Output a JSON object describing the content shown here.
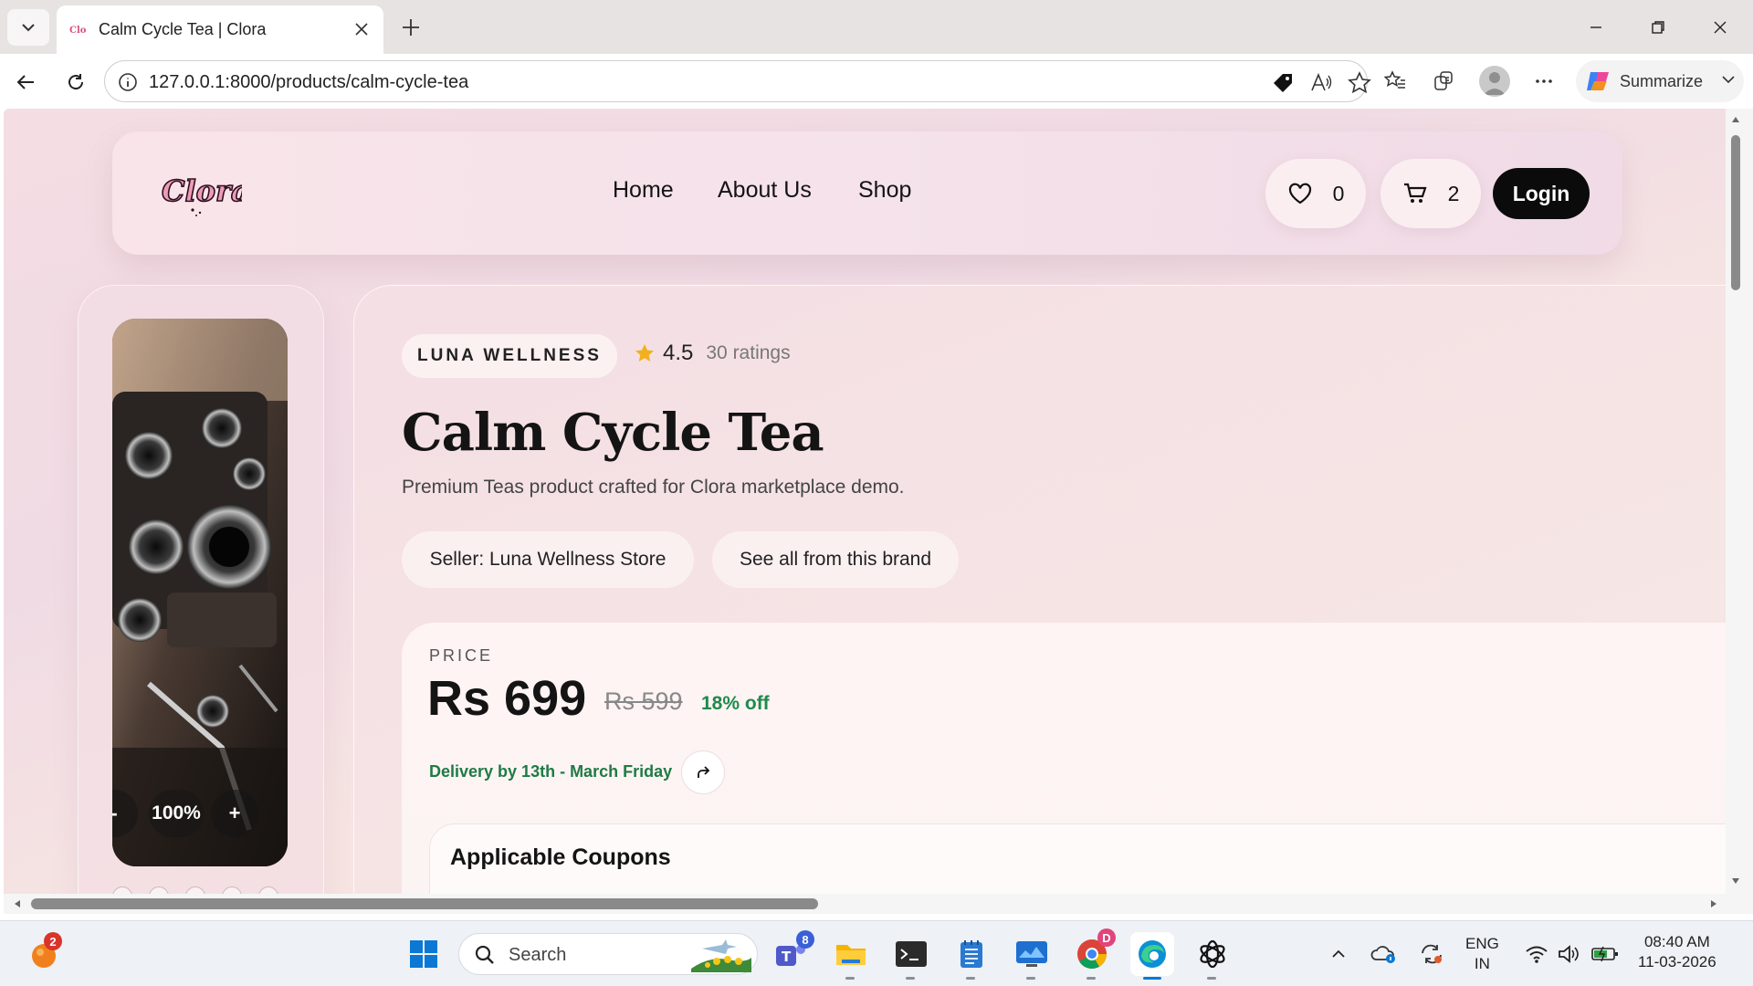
{
  "browser": {
    "tab_title": "Calm Cycle Tea | Clora",
    "url": "127.0.0.1:8000/products/calm-cycle-tea",
    "summarize_label": "Summarize"
  },
  "header": {
    "logo_text": "Clora",
    "nav": [
      "Home",
      "About Us",
      "Shop"
    ],
    "wishlist_count": "0",
    "cart_count": "2",
    "login_label": "Login"
  },
  "gallery": {
    "zoom_out": "-",
    "zoom_level": "100%",
    "zoom_in": "+"
  },
  "product": {
    "brand": "LUNA WELLNESS",
    "rating": "4.5",
    "rating_count": "30 ratings",
    "title": "Calm Cycle Tea",
    "subtitle": "Premium Teas product crafted for Clora marketplace demo.",
    "seller_chip": "Seller: Luna Wellness Store",
    "brand_chip": "See all from this brand",
    "price_label": "PRICE",
    "price_now": "Rs 699",
    "price_old": "Rs 599",
    "price_off": "18% off",
    "delivery": "Delivery by 13th - March Friday",
    "coupons_title": "Applicable Coupons"
  },
  "taskbar": {
    "search_placeholder": "Search",
    "notif_count": "2",
    "teams_badge": "8",
    "chrome_badge": "D",
    "lang_top": "ENG",
    "lang_bottom": "IN",
    "time": "08:40 AM",
    "date": "11-03-2026"
  },
  "colors": {
    "accent_dark": "#0b0b0b",
    "discount_green": "#1f8a4c",
    "star": "#f2b01e",
    "page_bg": "#f4dde3"
  }
}
